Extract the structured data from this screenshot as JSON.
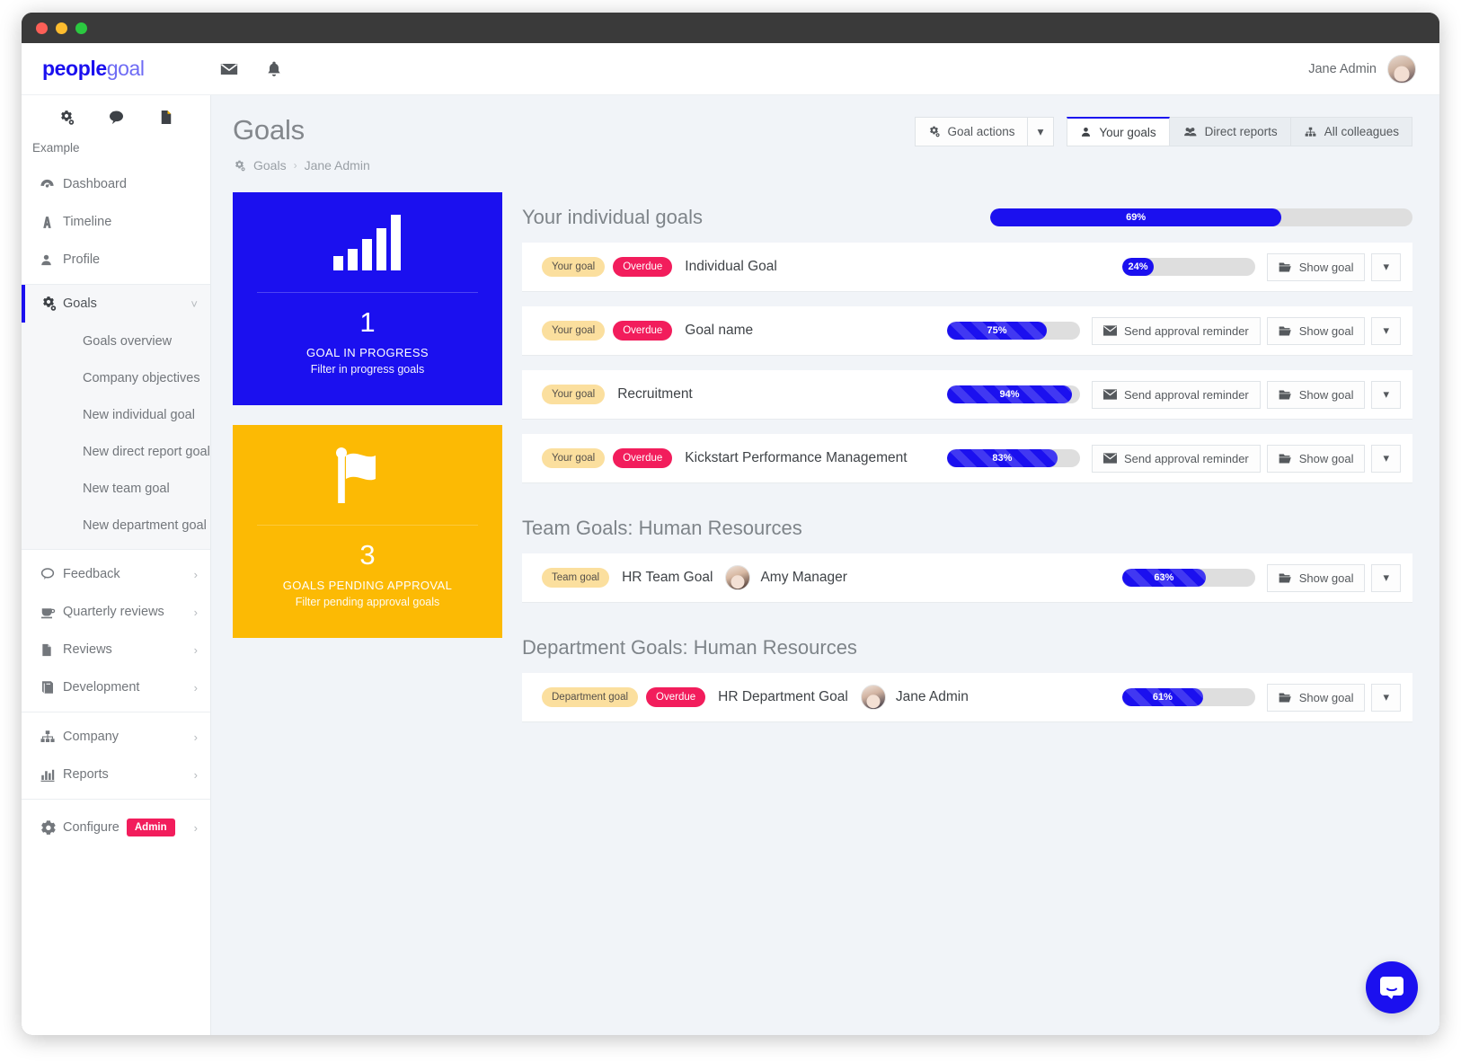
{
  "window": {
    "title": "peoplegoal"
  },
  "brand": {
    "part1": "people",
    "part2": "goal"
  },
  "topbar": {
    "mail_icon": "envelope-icon",
    "bell_icon": "bell-icon",
    "username": "Jane Admin"
  },
  "sidebar": {
    "quick_icons": [
      "settings-gears-icon",
      "chat-bubble-icon",
      "document-icon"
    ],
    "org_name": "Example",
    "items": [
      {
        "label": "Dashboard",
        "icon": "dashboard-icon",
        "chevron": ""
      },
      {
        "label": "Timeline",
        "icon": "timeline-icon",
        "chevron": ""
      },
      {
        "label": "Profile",
        "icon": "person-icon",
        "chevron": ""
      },
      {
        "label": "Goals",
        "icon": "gears-icon",
        "chevron": "down",
        "active": true
      },
      {
        "label": "Feedback",
        "icon": "speech-bubble-icon",
        "chevron": "right"
      },
      {
        "label": "Quarterly reviews",
        "icon": "coffee-cup-icon",
        "chevron": "right"
      },
      {
        "label": "Reviews",
        "icon": "document-icon",
        "chevron": "right"
      },
      {
        "label": "Development",
        "icon": "book-icon",
        "chevron": "right"
      },
      {
        "label": "Company",
        "icon": "org-chart-icon",
        "chevron": "right"
      },
      {
        "label": "Reports",
        "icon": "bar-chart-icon",
        "chevron": "right"
      },
      {
        "label": "Configure",
        "icon": "gear-icon",
        "chevron": "right",
        "badge": "Admin"
      }
    ],
    "goals_submenu": [
      "Goals overview",
      "Company objectives",
      "New individual goal",
      "New direct report goal",
      "New team goal",
      "New department goal"
    ]
  },
  "page": {
    "title": "Goals",
    "breadcrumb": {
      "icon": "gears-icon",
      "root": "Goals",
      "separator": "›",
      "current": "Jane Admin"
    }
  },
  "header_actions": {
    "goal_actions_label": "Goal actions",
    "goal_actions_icon": "gears-icon",
    "dropdown_caret": "▾",
    "tabs": [
      {
        "label": "Your goals",
        "icon": "person-icon",
        "active": true
      },
      {
        "label": "Direct reports",
        "icon": "people-icon",
        "active": false
      },
      {
        "label": "All colleagues",
        "icon": "org-chart-icon",
        "active": false
      }
    ]
  },
  "stat_cards": [
    {
      "icon": "bar-chart-icon",
      "number": "1",
      "label": "GOAL IN PROGRESS",
      "sublabel": "Filter in progress goals",
      "color": "#1b10ef"
    },
    {
      "icon": "flag-icon",
      "number": "3",
      "label": "GOALS PENDING APPROVAL",
      "sublabel": "Filter pending approval goals",
      "color": "#fcba04"
    }
  ],
  "sections": [
    {
      "title": "Your individual goals",
      "progress": {
        "value": 69,
        "text": "69%",
        "striped": false
      },
      "has_bar": true,
      "rows": [
        {
          "tags": [
            {
              "text": "Your goal",
              "type": "your"
            },
            {
              "text": "Overdue",
              "type": "overdue"
            }
          ],
          "name": "Individual Goal",
          "owner": null,
          "progress": {
            "value": 24,
            "text": "24%",
            "striped": false
          },
          "buttons": [
            {
              "label": "Show goal",
              "icon": "folder-open-icon"
            }
          ],
          "caret": "▾"
        },
        {
          "tags": [
            {
              "text": "Your goal",
              "type": "your"
            },
            {
              "text": "Overdue",
              "type": "overdue"
            }
          ],
          "name": "Goal name",
          "owner": null,
          "progress": {
            "value": 75,
            "text": "75%",
            "striped": true
          },
          "buttons": [
            {
              "label": "Send approval reminder",
              "icon": "envelope-icon"
            },
            {
              "label": "Show goal",
              "icon": "folder-open-icon"
            }
          ],
          "caret": "▾"
        },
        {
          "tags": [
            {
              "text": "Your goal",
              "type": "your"
            }
          ],
          "name": "Recruitment",
          "owner": null,
          "progress": {
            "value": 94,
            "text": "94%",
            "striped": true
          },
          "buttons": [
            {
              "label": "Send approval reminder",
              "icon": "envelope-icon"
            },
            {
              "label": "Show goal",
              "icon": "folder-open-icon"
            }
          ],
          "caret": "▾"
        },
        {
          "tags": [
            {
              "text": "Your goal",
              "type": "your"
            },
            {
              "text": "Overdue",
              "type": "overdue"
            }
          ],
          "name": "Kickstart Performance Management",
          "owner": null,
          "progress": {
            "value": 83,
            "text": "83%",
            "striped": true
          },
          "buttons": [
            {
              "label": "Send approval reminder",
              "icon": "envelope-icon"
            },
            {
              "label": "Show goal",
              "icon": "folder-open-icon"
            }
          ],
          "caret": "▾"
        }
      ]
    },
    {
      "title": "Team Goals: Human Resources",
      "has_bar": false,
      "rows": [
        {
          "tags": [
            {
              "text": "Team goal",
              "type": "team"
            }
          ],
          "name": "HR Team Goal",
          "owner": {
            "name": "Amy Manager",
            "avatar": "amy"
          },
          "progress": {
            "value": 63,
            "text": "63%",
            "striped": true
          },
          "buttons": [
            {
              "label": "Show goal",
              "icon": "folder-open-icon"
            }
          ],
          "caret": "▾"
        }
      ]
    },
    {
      "title": "Department Goals: Human Resources",
      "has_bar": false,
      "rows": [
        {
          "tags": [
            {
              "text": "Department goal",
              "type": "dept"
            },
            {
              "text": "Overdue",
              "type": "overdue"
            }
          ],
          "name": "HR Department Goal",
          "owner": {
            "name": "Jane Admin",
            "avatar": "jane"
          },
          "progress": {
            "value": 61,
            "text": "61%",
            "striped": true
          },
          "buttons": [
            {
              "label": "Show goal",
              "icon": "folder-open-icon"
            }
          ],
          "caret": "▾"
        }
      ]
    }
  ],
  "chat_widget": {
    "icon": "chat-bubble-icon",
    "color": "#1b10ef"
  },
  "colors": {
    "brand_blue": "#1b10ef",
    "accent_yellow": "#fcba04",
    "danger_pink": "#f21d5c",
    "tag_yellow": "#fbdf9e",
    "page_bg": "#f1f4f8"
  }
}
